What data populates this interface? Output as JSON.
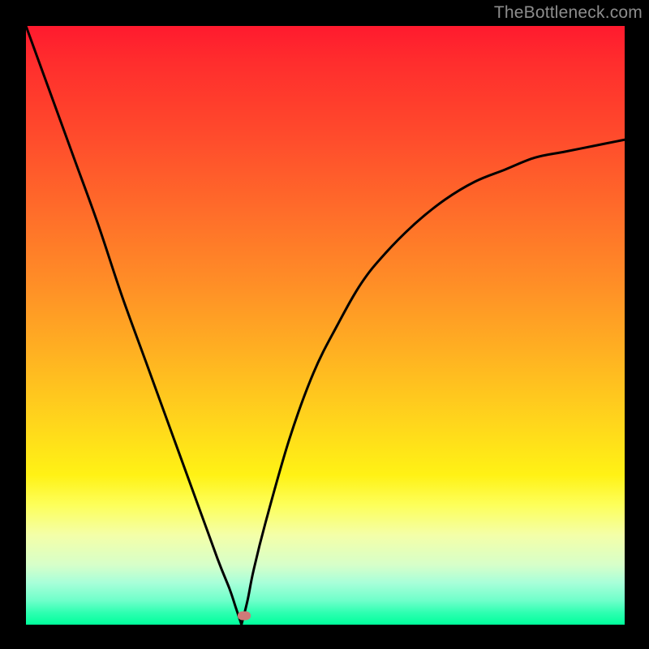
{
  "watermark": "TheBottleneck.com",
  "colors": {
    "frame": "#000000",
    "curve": "#000000",
    "marker": "#cf7a78",
    "watermark": "#8d8d8d"
  },
  "chart_data": {
    "type": "line",
    "title": "",
    "xlabel": "",
    "ylabel": "",
    "xlim": [
      0,
      100
    ],
    "ylim": [
      0,
      100
    ],
    "grid": false,
    "legend": false,
    "annotations": [],
    "vertex_x": 36,
    "series": [
      {
        "name": "left-branch",
        "x": [
          0,
          4,
          8,
          12,
          16,
          20,
          24,
          28,
          32,
          34,
          35,
          36
        ],
        "values": [
          100,
          89,
          78,
          67,
          55,
          44,
          33,
          22,
          11,
          6,
          3,
          0
        ]
      },
      {
        "name": "right-branch",
        "x": [
          36,
          37,
          38,
          40,
          44,
          48,
          52,
          56,
          60,
          65,
          70,
          75,
          80,
          85,
          90,
          95,
          100
        ],
        "values": [
          0,
          4,
          9,
          17,
          31,
          42,
          50,
          57,
          62,
          67,
          71,
          74,
          76,
          78,
          79,
          80,
          81
        ]
      }
    ],
    "marker": {
      "x": 36.5,
      "y": 1.5
    }
  }
}
